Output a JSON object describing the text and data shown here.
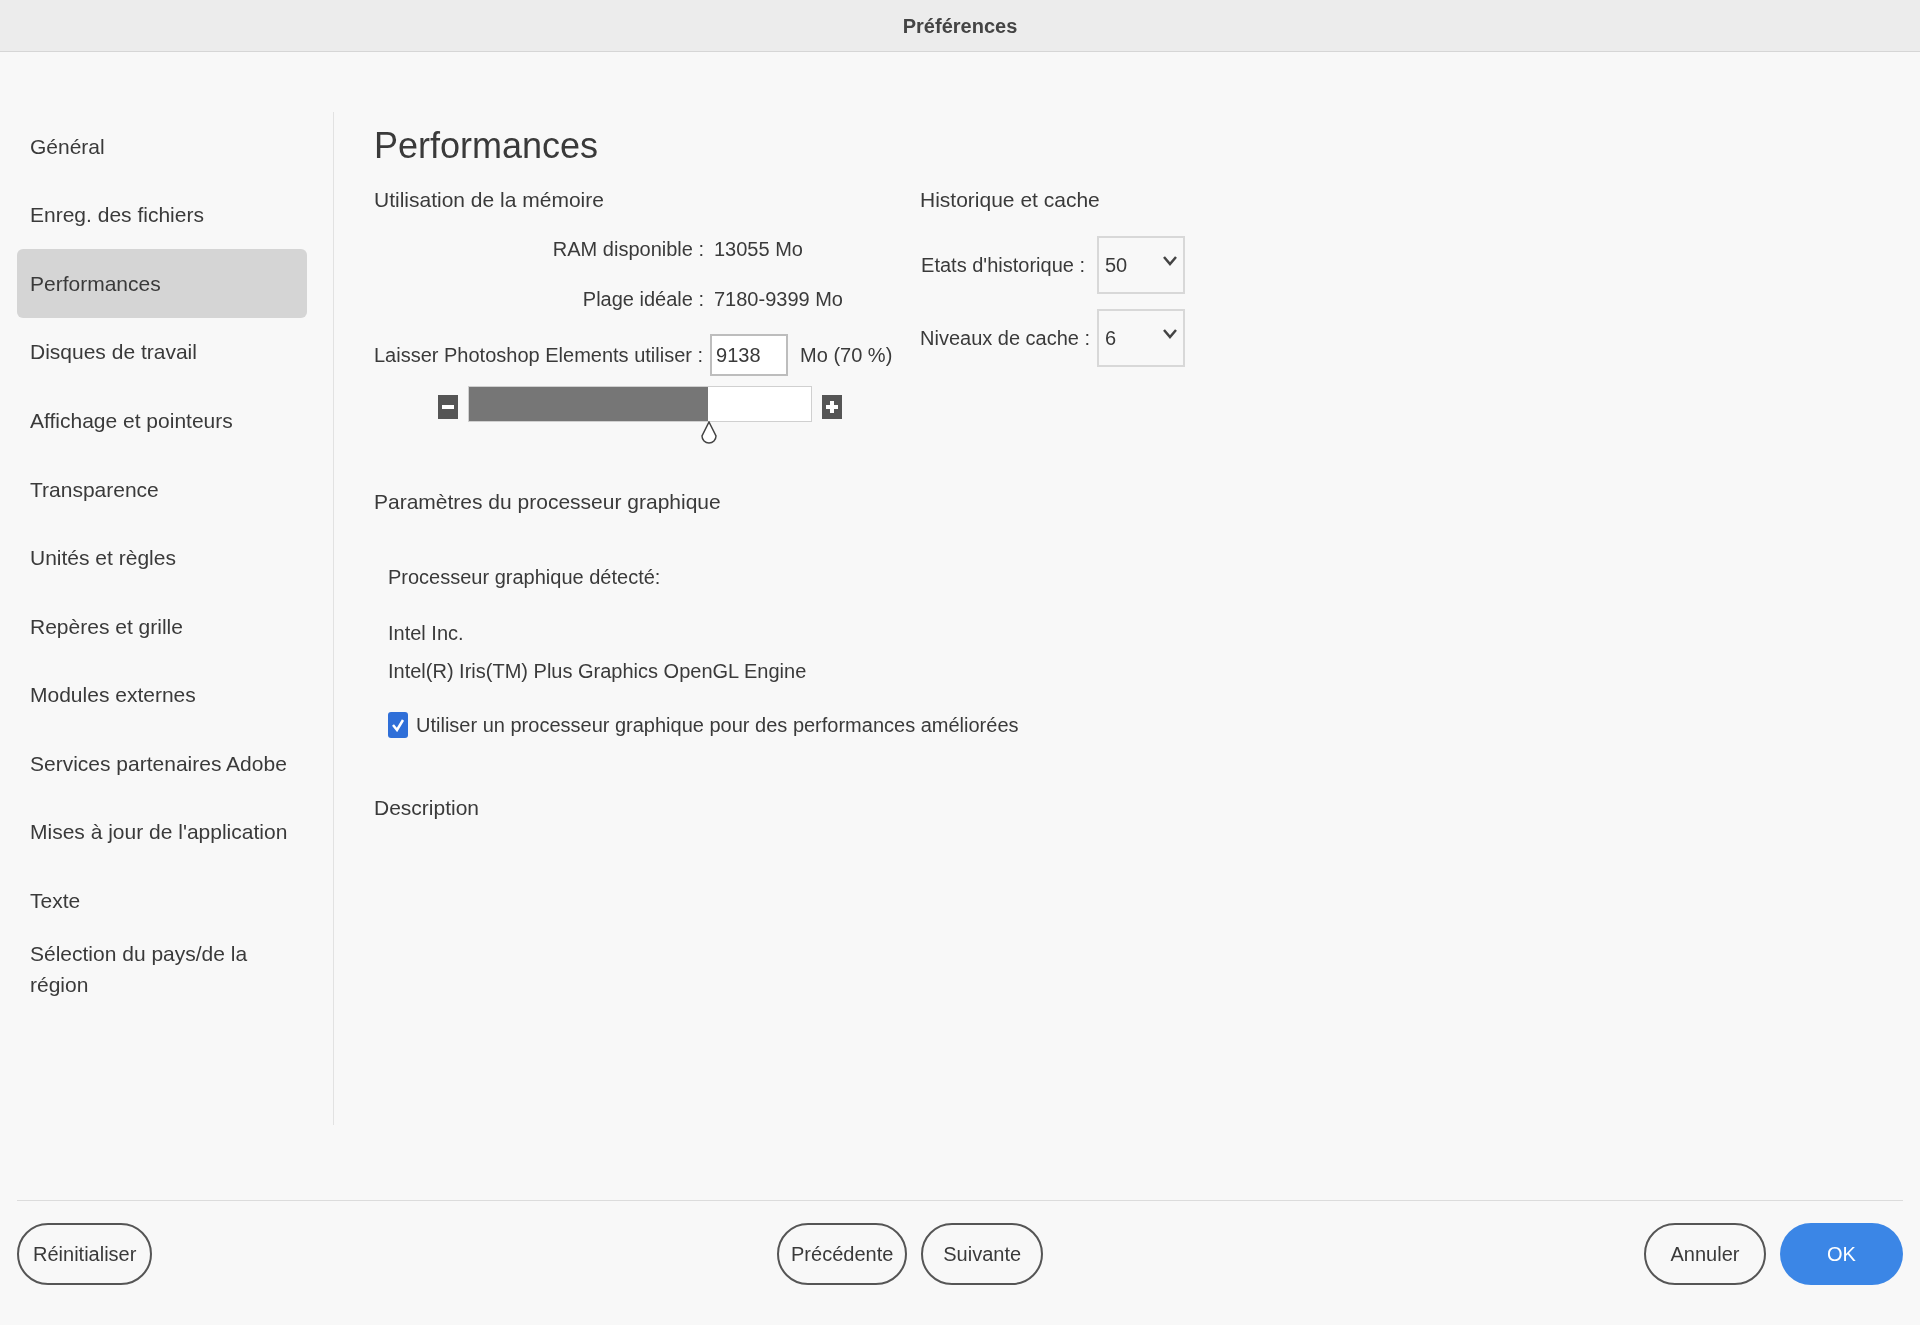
{
  "window": {
    "title": "Préférences"
  },
  "sidebar": {
    "items": [
      {
        "label": "Général",
        "selected": false
      },
      {
        "label": "Enreg. des fichiers",
        "selected": false
      },
      {
        "label": "Performances",
        "selected": true
      },
      {
        "label": "Disques de travail",
        "selected": false
      },
      {
        "label": "Affichage et pointeurs",
        "selected": false
      },
      {
        "label": "Transparence",
        "selected": false
      },
      {
        "label": "Unités et règles",
        "selected": false
      },
      {
        "label": "Repères et grille",
        "selected": false
      },
      {
        "label": "Modules externes",
        "selected": false
      },
      {
        "label": "Services partenaires Adobe",
        "selected": false
      },
      {
        "label": "Mises à jour de l'application",
        "selected": false
      },
      {
        "label": "Texte",
        "selected": false
      },
      {
        "label": "Sélection du pays/de la région",
        "selected": false
      }
    ]
  },
  "page": {
    "title": "Performances",
    "memory": {
      "heading": "Utilisation de la mémoire",
      "rows": [
        {
          "label": "RAM disponible :",
          "value": "13055 Mo"
        },
        {
          "label": "Plage idéale :",
          "value": "7180-9399 Mo"
        }
      ],
      "use_label": "Laisser Photoshop Elements utiliser :",
      "use_value": "9138",
      "use_unit": "Mo (70 %)",
      "slider": {
        "level": 0.7
      }
    },
    "history": {
      "heading": "Historique et cache",
      "fields": [
        {
          "label": "Etats d'historique :",
          "value": "50"
        },
        {
          "label": "Niveaux de cache :",
          "value": "6"
        }
      ]
    },
    "gpu": {
      "heading": "Paramètres du processeur graphique",
      "detected_label": "Processeur graphique détecté:",
      "vendor": "Intel Inc.",
      "renderer": "Intel(R) Iris(TM) Plus Graphics OpenGL Engine",
      "checkbox": {
        "label": "Utiliser un processeur graphique pour des performances améliorées",
        "checked": true
      }
    },
    "description": {
      "heading": "Description"
    }
  },
  "footer": {
    "reset": "Réinitialiser",
    "previous": "Précédente",
    "next": "Suivante",
    "cancel": "Annuler",
    "ok": "OK"
  }
}
